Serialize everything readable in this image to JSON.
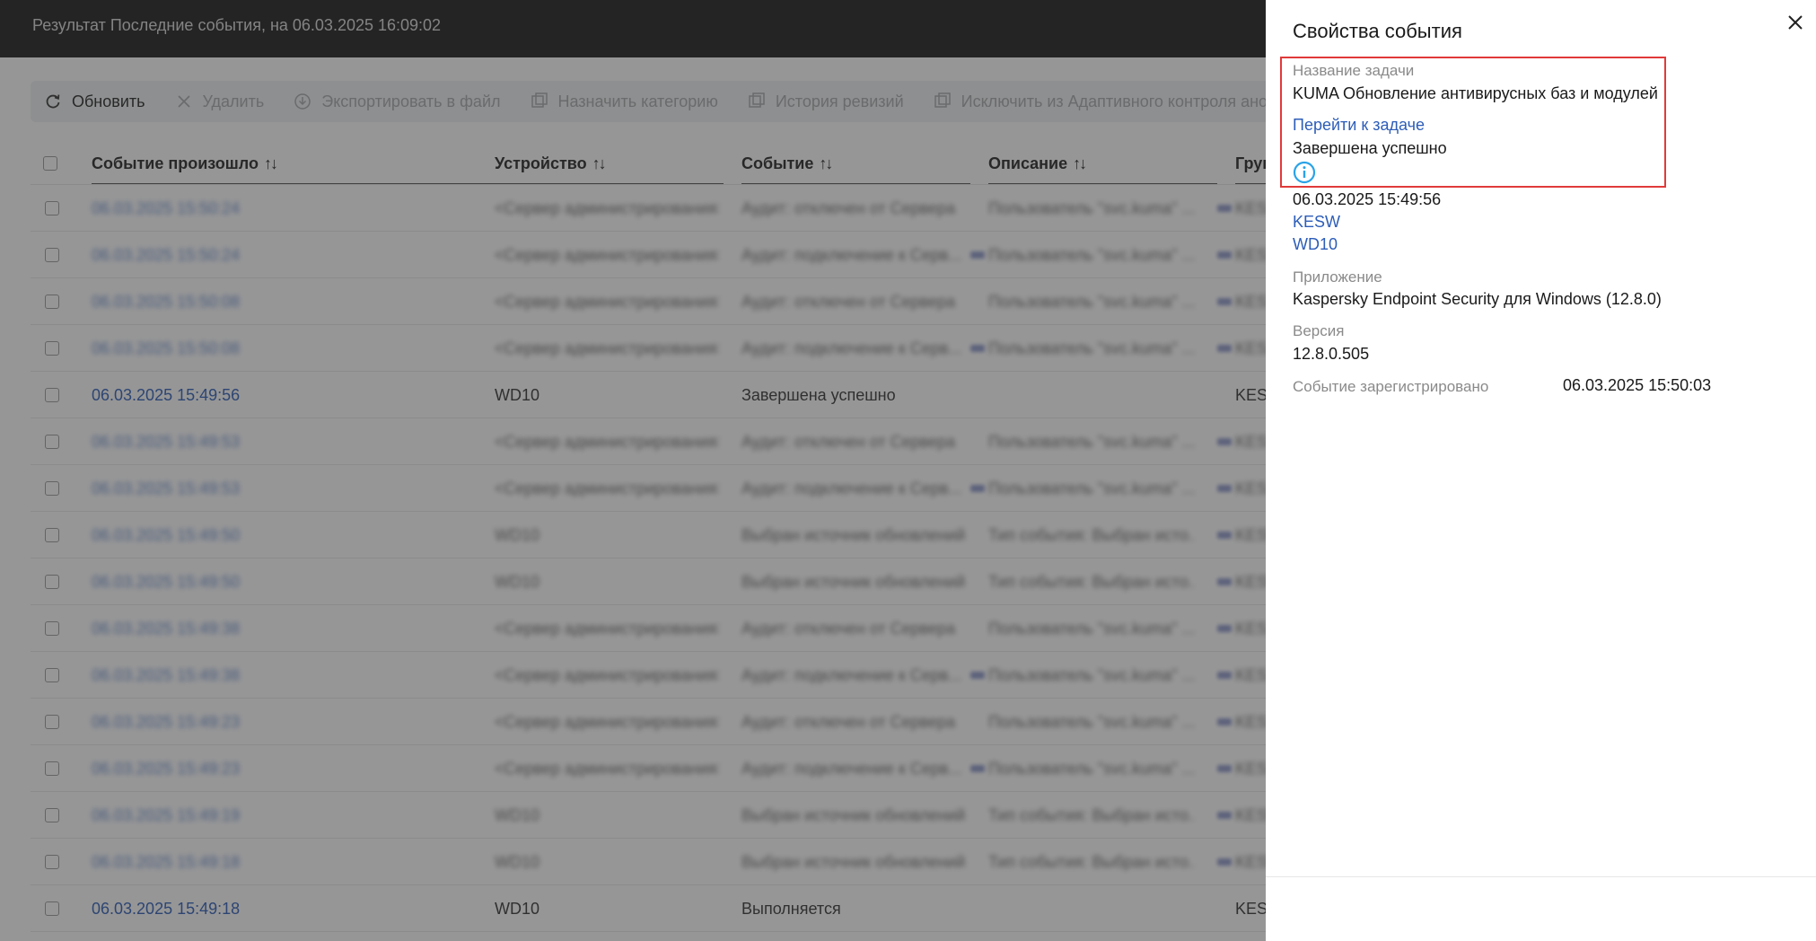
{
  "header": {
    "title": "Результат Последние события, на 06.03.2025 16:09:02"
  },
  "toolbar": {
    "refresh": "Обновить",
    "delete": "Удалить",
    "export": "Экспортировать в файл",
    "assign_category": "Назначить категорию",
    "revision_history": "История ревизий",
    "exclude": "Исключить из Адаптивного контроля аномалий"
  },
  "table": {
    "columns": [
      "Событие произошло",
      "Устройство",
      "Событие",
      "Описание",
      "Груп"
    ],
    "rows": [
      {
        "date": "06.03.2025 15:50:24",
        "device": "<Сервер администрирования>",
        "event": "Аудит: отключен от Сервера",
        "description": "Пользователь \"svc.kuma\" ...",
        "group": "KES",
        "blurred": true
      },
      {
        "date": "06.03.2025 15:50:24",
        "device": "<Сервер администрирования>",
        "event": "Аудит: подключение к Серв...",
        "description": "Пользователь \"svc.kuma\" ...",
        "group": "KES",
        "blurred": true
      },
      {
        "date": "06.03.2025 15:50:08",
        "device": "<Сервер администрирования>",
        "event": "Аудит: отключен от Сервера",
        "description": "Пользователь \"svc.kuma\" ...",
        "group": "KES",
        "blurred": true
      },
      {
        "date": "06.03.2025 15:50:08",
        "device": "<Сервер администрирования>",
        "event": "Аудит: подключение к Серв...",
        "description": "Пользователь \"svc.kuma\" ...",
        "group": "KES",
        "blurred": true
      },
      {
        "date": "06.03.2025 15:49:56",
        "device": "WD10",
        "event": "Завершена успешно",
        "description": "",
        "group": "KESW",
        "blurred": false
      },
      {
        "date": "06.03.2025 15:49:53",
        "device": "<Сервер администрирования>",
        "event": "Аудит: отключен от Сервера",
        "description": "Пользователь \"svc.kuma\" ...",
        "group": "KES",
        "blurred": true
      },
      {
        "date": "06.03.2025 15:49:53",
        "device": "<Сервер администрирования>",
        "event": "Аудит: подключение к Серв...",
        "description": "Пользователь \"svc.kuma\" ...",
        "group": "KES",
        "blurred": true
      },
      {
        "date": "06.03.2025 15:49:50",
        "device": "WD10",
        "event": "Выбран источник обновлений",
        "description": "Тип события: Выбран исто...",
        "group": "KESW",
        "blurred": true
      },
      {
        "date": "06.03.2025 15:49:50",
        "device": "WD10",
        "event": "Выбран источник обновлений",
        "description": "Тип события: Выбран исто...",
        "group": "KESW",
        "blurred": true
      },
      {
        "date": "06.03.2025 15:49:38",
        "device": "<Сервер администрирования>",
        "event": "Аудит: отключен от Сервера",
        "description": "Пользователь \"svc.kuma\" ...",
        "group": "KES",
        "blurred": true
      },
      {
        "date": "06.03.2025 15:49:38",
        "device": "<Сервер администрирования>",
        "event": "Аудит: подключение к Серв...",
        "description": "Пользователь \"svc.kuma\" ...",
        "group": "KES",
        "blurred": true
      },
      {
        "date": "06.03.2025 15:49:23",
        "device": "<Сервер администрирования>",
        "event": "Аудит: отключен от Сервера",
        "description": "Пользователь \"svc.kuma\" ...",
        "group": "KES",
        "blurred": true
      },
      {
        "date": "06.03.2025 15:49:23",
        "device": "<Сервер администрирования>",
        "event": "Аудит: подключение к Серв...",
        "description": "Пользователь \"svc.kuma\" ...",
        "group": "KES",
        "blurred": true
      },
      {
        "date": "06.03.2025 15:49:19",
        "device": "WD10",
        "event": "Выбран источник обновлений",
        "description": "Тип события: Выбран исто...",
        "group": "KESW",
        "blurred": true
      },
      {
        "date": "06.03.2025 15:49:18",
        "device": "WD10",
        "event": "Выбран источник обновлений",
        "description": "Тип события: Выбран исто...",
        "group": "KESW",
        "blurred": true
      },
      {
        "date": "06.03.2025 15:49:18",
        "device": "WD10",
        "event": "Выполняется",
        "description": "",
        "group": "KESW",
        "blurred": false
      }
    ]
  },
  "panel": {
    "title": "Свойства события",
    "task_name_label": "Название задачи",
    "task_name_value": "KUMA Обновление антивирусных баз и модулей",
    "go_to_task": "Перейти к задаче",
    "status": "Завершена успешно",
    "date": "06.03.2025 15:49:56",
    "group_link": "KESW",
    "device_link": "WD10",
    "app_label": "Приложение",
    "app_value": "Kaspersky Endpoint Security для Windows (12.8.0)",
    "version_label": "Версия",
    "version_value": "12.8.0.505",
    "registered_label": "Событие зарегистрировано",
    "registered_value": "06.03.2025 15:50:03"
  },
  "colors": {
    "link": "#2d5db8",
    "highlight": "#e03a3a",
    "info_icon": "#2aa3e8",
    "topbar": "#1b1b1b"
  }
}
